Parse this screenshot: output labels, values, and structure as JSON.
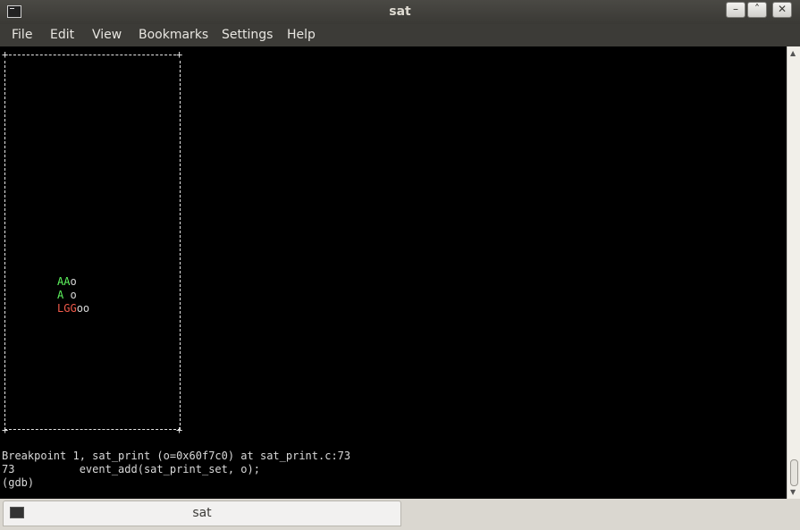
{
  "window": {
    "title": "sat",
    "buttons": [
      "–",
      "˄",
      "✕"
    ]
  },
  "menubar": {
    "items": [
      "File",
      "Edit",
      "View",
      "Bookmarks",
      "Settings",
      "Help"
    ]
  },
  "terminal": {
    "board": {
      "row1": {
        "a": "AA",
        "b": "o"
      },
      "row2": {
        "a": "A",
        "b": " o"
      },
      "row3": {
        "a": "LGG",
        "b": "oo"
      }
    },
    "output": [
      "Breakpoint 1, sat_print (o=0x60f7c0) at sat_print.c:73",
      "73          event_add(sat_print_set, o);",
      "(gdb)"
    ]
  },
  "tab": {
    "label": "sat",
    "icon": "terminal-icon"
  },
  "colors": {
    "green_piece": "#5ff75f",
    "red_piece": "#f25b4b",
    "terminal_bg": "#000000"
  }
}
